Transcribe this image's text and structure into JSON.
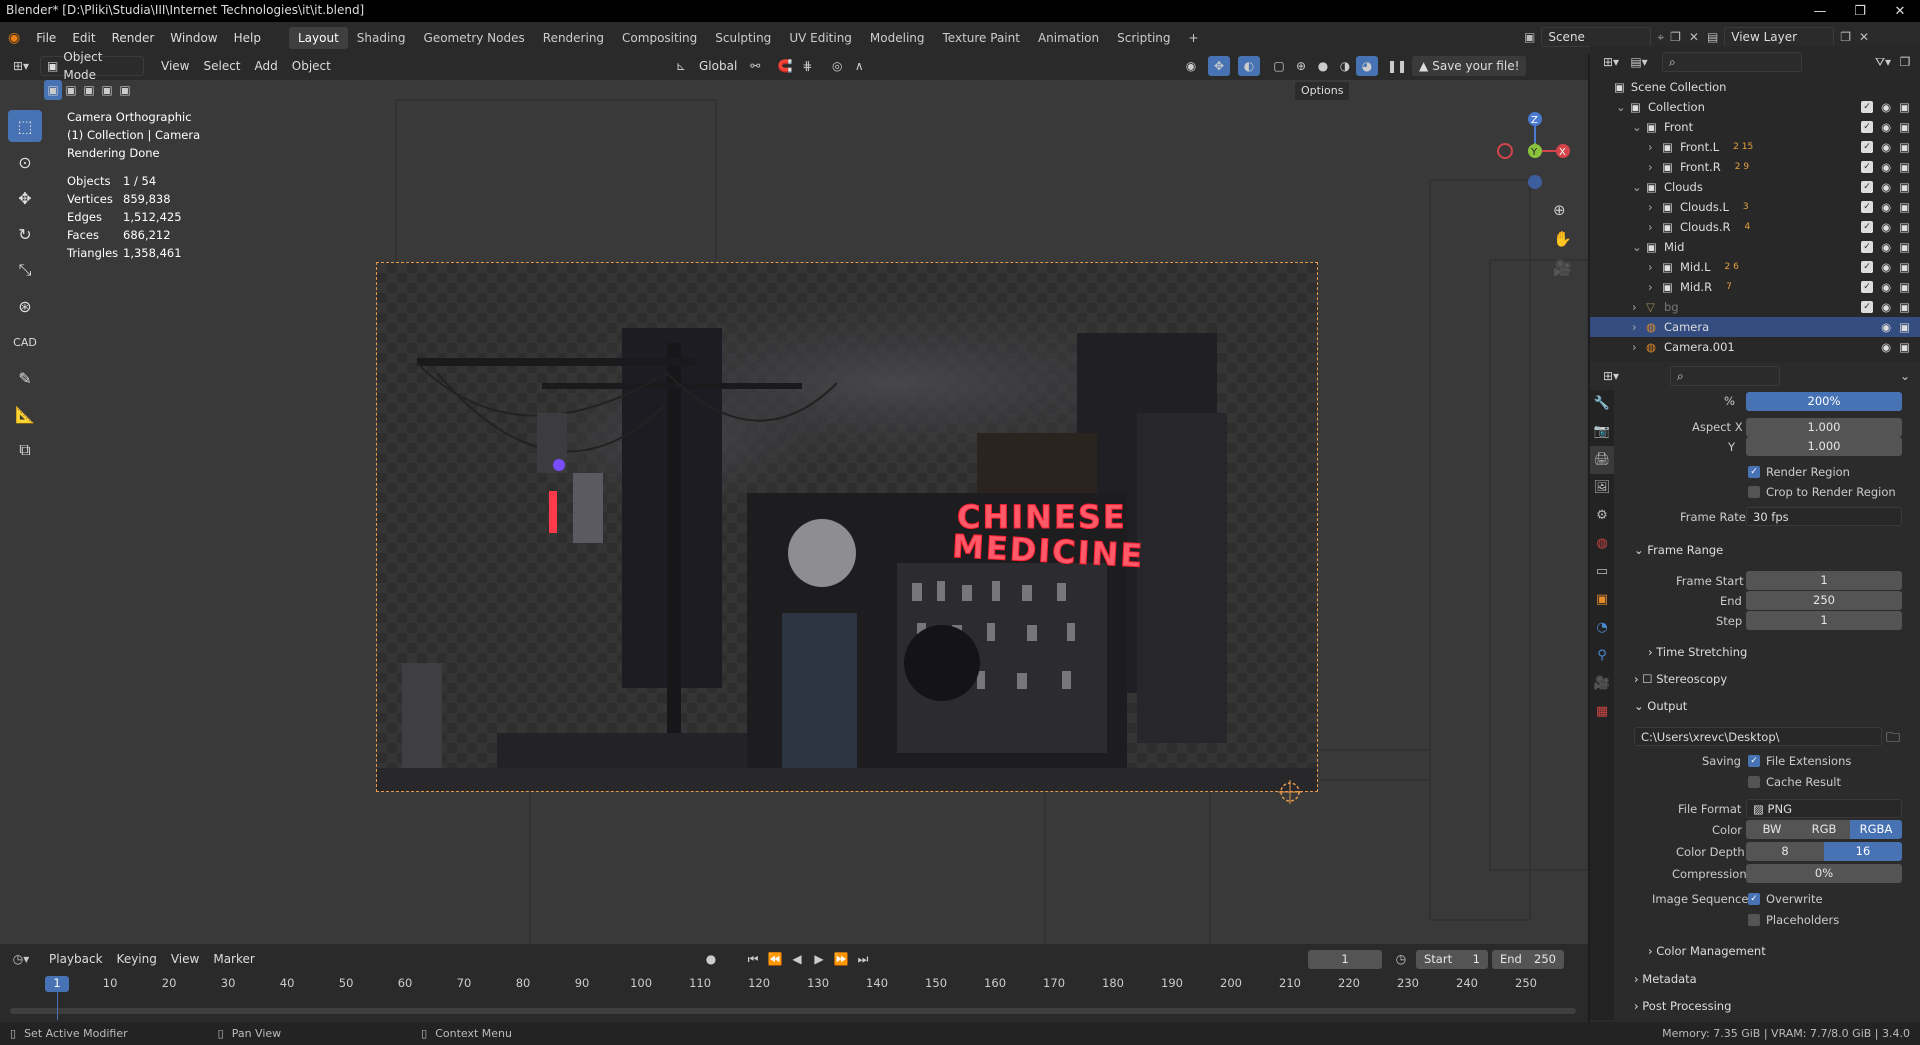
{
  "window": {
    "title": "Blender* [D:\\Pliki\\Studia\\III\\Internet Technologies\\it\\it.blend]"
  },
  "menu": [
    "File",
    "Edit",
    "Render",
    "Window",
    "Help"
  ],
  "workspaces": [
    "Layout",
    "Shading",
    "Geometry Nodes",
    "Rendering",
    "Compositing",
    "Sculpting",
    "UV Editing",
    "Modeling",
    "Texture Paint",
    "Animation",
    "Scripting"
  ],
  "scene": {
    "name": "Scene",
    "view_layer": "View Layer"
  },
  "header3d": {
    "mode": "Object Mode",
    "menus": [
      "View",
      "Select",
      "Add",
      "Object"
    ],
    "orientation": "Global",
    "save_warning": "Save your file!",
    "options": "Options"
  },
  "stats": {
    "line1": "Camera Orthographic",
    "line2": "(1) Collection | Camera",
    "line3": "Rendering Done",
    "rows": [
      {
        "label": "Objects",
        "value": "1 / 54"
      },
      {
        "label": "Vertices",
        "value": "859,838"
      },
      {
        "label": "Edges",
        "value": "1,512,425"
      },
      {
        "label": "Faces",
        "value": "686,212"
      },
      {
        "label": "Triangles",
        "value": "1,358,461"
      }
    ]
  },
  "scene_art": {
    "neon_line1": "CHINESE",
    "neon_line2": "MEDICINE"
  },
  "outliner": {
    "root": "Scene Collection",
    "items": [
      {
        "label": "Collection",
        "badge": ""
      },
      {
        "label": "Front",
        "badge": ""
      },
      {
        "label": "Front.L",
        "badge": "2  15"
      },
      {
        "label": "Front.R",
        "badge": "2  9"
      },
      {
        "label": "Clouds",
        "badge": ""
      },
      {
        "label": "Clouds.L",
        "badge": "3"
      },
      {
        "label": "Clouds.R",
        "badge": "4"
      },
      {
        "label": "Mid",
        "badge": ""
      },
      {
        "label": "Mid.L",
        "badge": "2  6"
      },
      {
        "label": "Mid.R",
        "badge": "7"
      },
      {
        "label": "bg",
        "badge": ""
      },
      {
        "label": "Camera",
        "badge": ""
      },
      {
        "label": "Camera.001",
        "badge": ""
      }
    ]
  },
  "props": {
    "percent_label": "%",
    "percent": "200%",
    "aspect_x_label": "Aspect X",
    "aspect_x": "1.000",
    "aspect_y_label": "Y",
    "aspect_y": "1.000",
    "render_region": "Render Region",
    "crop_region": "Crop to Render Region",
    "frame_rate_label": "Frame Rate",
    "frame_rate": "30 fps",
    "frame_range": "Frame Range",
    "frame_start_label": "Frame Start",
    "frame_start": "1",
    "end_label": "End",
    "end": "250",
    "step_label": "Step",
    "step": "1",
    "time_stretching": "Time Stretching",
    "stereoscopy": "Stereoscopy",
    "output": "Output",
    "output_path": "C:\\Users\\xrevc\\Desktop\\",
    "saving_label": "Saving",
    "file_extensions": "File Extensions",
    "cache_result": "Cache Result",
    "file_format_label": "File Format",
    "file_format": "PNG",
    "color_label": "Color",
    "color_opts": [
      "BW",
      "RGB",
      "RGBA"
    ],
    "color_depth_label": "Color Depth",
    "depth_opts": [
      "8",
      "16"
    ],
    "compression_label": "Compression",
    "compression": "0%",
    "image_seq_label": "Image Sequence",
    "overwrite": "Overwrite",
    "placeholders": "Placeholders",
    "color_management": "Color Management",
    "metadata": "Metadata",
    "post_processing": "Post Processing"
  },
  "timeline": {
    "menus": [
      "Playback",
      "Keying",
      "View",
      "Marker"
    ],
    "current": "1",
    "start_label": "Start",
    "start": "1",
    "end_label": "End",
    "end": "250",
    "ticks": [
      "1",
      "10",
      "20",
      "30",
      "40",
      "50",
      "60",
      "70",
      "80",
      "90",
      "100",
      "110",
      "120",
      "130",
      "140",
      "150",
      "160",
      "170",
      "180",
      "190",
      "200",
      "210",
      "220",
      "230",
      "240",
      "250"
    ]
  },
  "status": {
    "left": "Set Active Modifier",
    "mid": "Pan View",
    "right": "Context Menu",
    "memory": "Memory: 7.35 GiB | VRAM: 7.7/8.0 GiB | 3.4.0"
  }
}
